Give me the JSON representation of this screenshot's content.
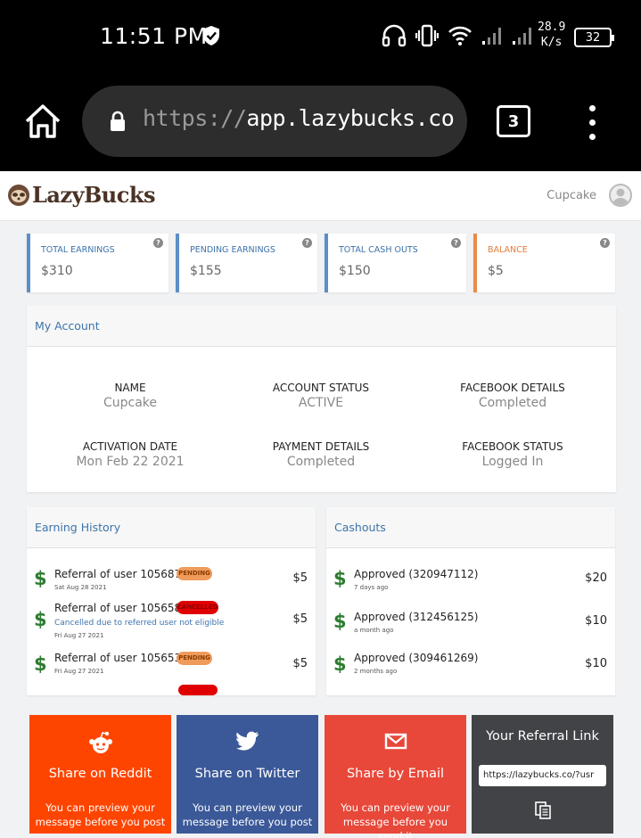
{
  "status_bar": {
    "time": "11:51 PM",
    "net_speed_value": "28.9",
    "net_speed_unit": "K/s",
    "battery": "32"
  },
  "browser": {
    "url_protocol": "https://",
    "url_host": "app.lazybucks.co",
    "tab_count": "3"
  },
  "app": {
    "brand": "LazyBucks",
    "username": "Cupcake"
  },
  "stats": [
    {
      "label": "TOTAL EARNINGS",
      "value": "$310"
    },
    {
      "label": "PENDING EARNINGS",
      "value": "$155"
    },
    {
      "label": "TOTAL CASH OUTS",
      "value": "$150"
    },
    {
      "label": "BALANCE",
      "value": "$5"
    }
  ],
  "stat_help": "?",
  "account": {
    "title": "My Account",
    "fields": [
      {
        "label": "NAME",
        "value": "Cupcake"
      },
      {
        "label": "ACCOUNT STATUS",
        "value": "ACTIVE"
      },
      {
        "label": "FACEBOOK DETAILS",
        "value": "Completed"
      },
      {
        "label": "ACTIVATION DATE",
        "value": "Mon Feb 22 2021"
      },
      {
        "label": "PAYMENT DETAILS",
        "value": "Completed"
      },
      {
        "label": "FACEBOOK STATUS",
        "value": "Logged In"
      }
    ]
  },
  "earning_history": {
    "title": "Earning History",
    "currency_symbol": "$",
    "items": [
      {
        "title": "Referral of user 105687",
        "badge": "PENDING",
        "date": "Sat Aug 28 2021",
        "amount": "$5"
      },
      {
        "title": "Referral of user 105658",
        "badge": "CANCELLED",
        "note": "Cancelled due to referred user not eligible",
        "date": "Fri Aug 27 2021",
        "amount": "$5"
      },
      {
        "title": "Referral of user 105653",
        "badge": "PENDING",
        "date": "Fri Aug 27 2021",
        "amount": "$5"
      }
    ]
  },
  "cashouts": {
    "title": "Cashouts",
    "currency_symbol": "$",
    "items": [
      {
        "title": "Approved (320947112)",
        "ago": "7 days ago",
        "amount": "$20"
      },
      {
        "title": "Approved (312456125)",
        "ago": "a month ago",
        "amount": "$10"
      },
      {
        "title": "Approved (309461269)",
        "ago": "2 months ago",
        "amount": "$10"
      }
    ]
  },
  "share": {
    "reddit": {
      "title": "Share on Reddit",
      "desc": "You can preview your message before you post",
      "color": "#fe4500"
    },
    "twitter": {
      "title": "Share on Twitter",
      "desc": "You can preview your message before you post",
      "color": "#3b5998"
    },
    "email": {
      "title": "Share by Email",
      "desc": "You can preview your message before you send it",
      "color": "#e8483a"
    },
    "referral": {
      "title": "Your Referral Link",
      "link": "https://lazybucks.co/?usr",
      "color": "#424347"
    }
  },
  "icons": [
    "shield-check-icon",
    "headphones-icon",
    "vibrate-icon",
    "wifi-icon",
    "signal-icon",
    "home-icon",
    "lock-icon",
    "more-vert-icon",
    "user-avatar-icon",
    "reddit-icon",
    "twitter-icon",
    "mail-icon",
    "copy-icon"
  ]
}
